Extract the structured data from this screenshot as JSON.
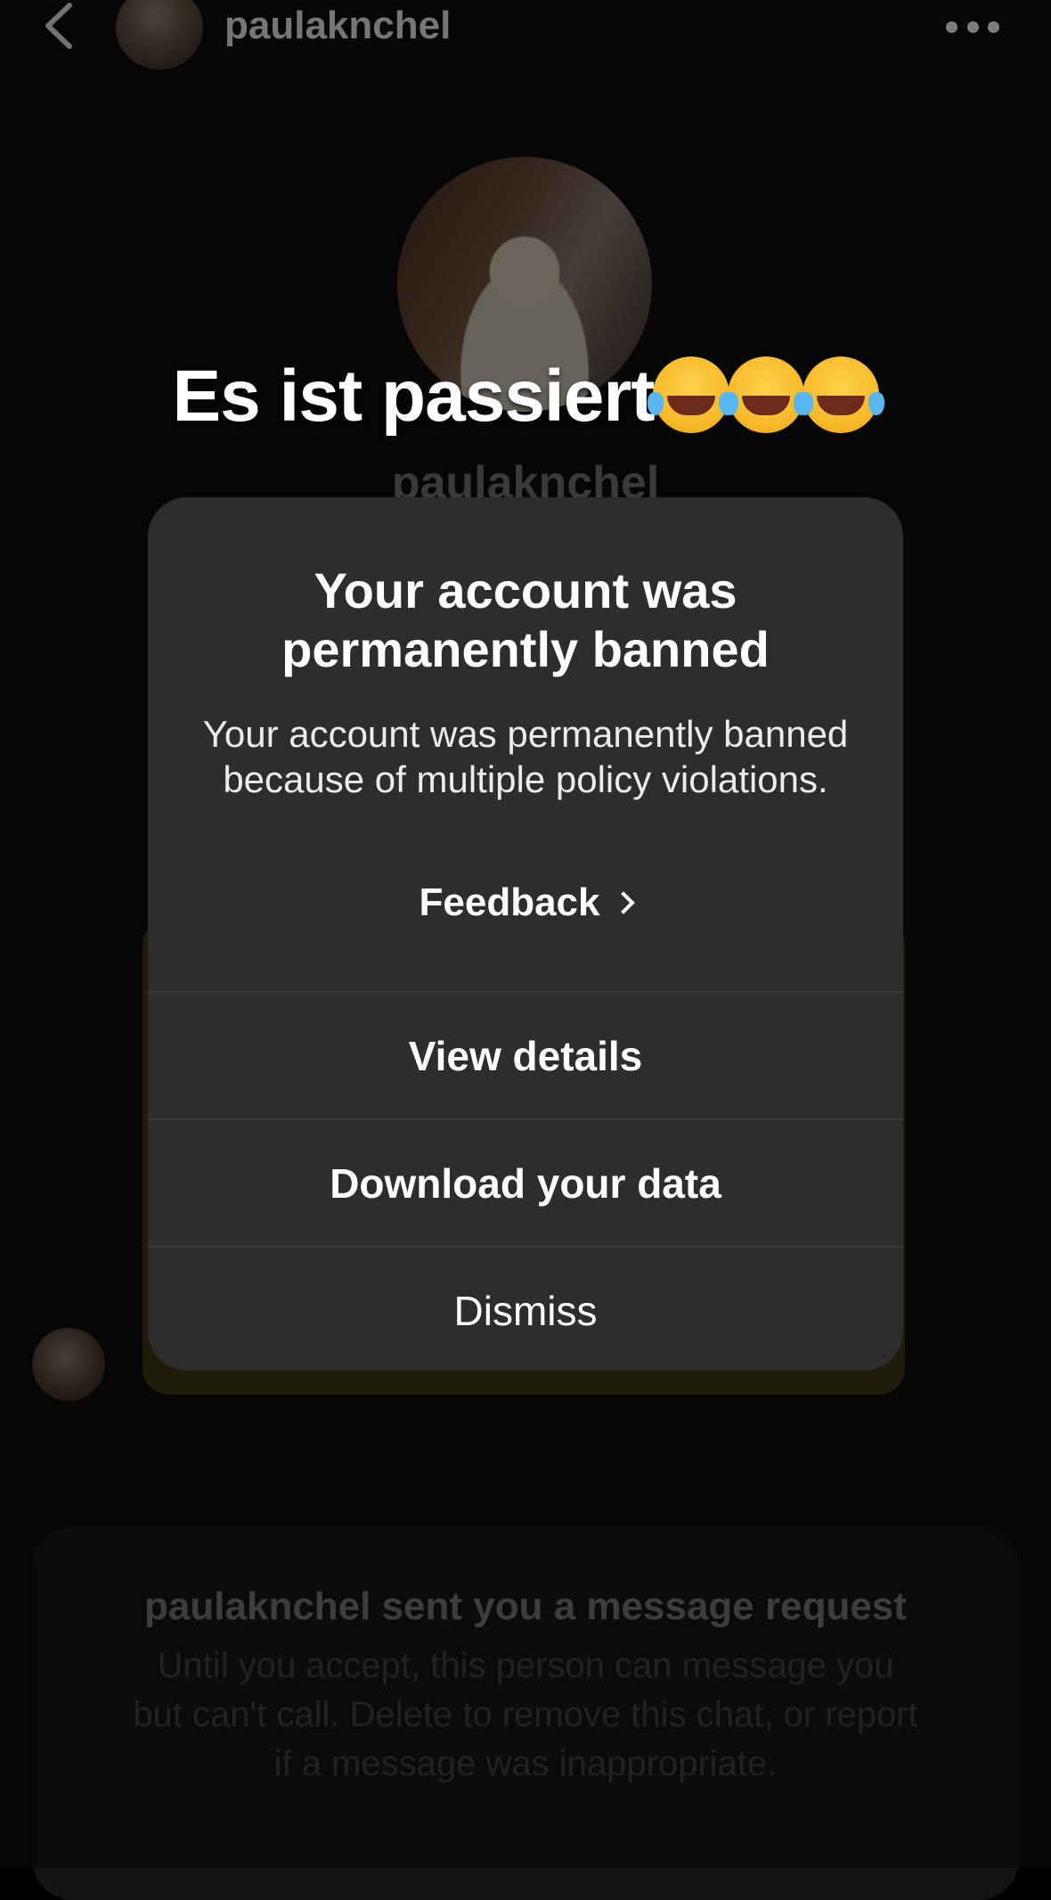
{
  "header": {
    "username": "paulaknchel"
  },
  "profile": {
    "username": "paulaknchel"
  },
  "overlay_caption": "Es ist passiert",
  "modal": {
    "title": "Your account was permanently banned",
    "body": "Your account was permanently banned because of multiple policy violations.",
    "feedback_label": "Feedback",
    "view_details_label": "View details",
    "download_label": "Download your data",
    "dismiss_label": "Dismiss"
  },
  "message_request": {
    "title": "paulaknchel sent you a message request",
    "body": "Until you accept, this person can message you but can't call. Delete to remove this chat, or report if a message was inappropriate."
  },
  "colors": {
    "modal_bg": "#2d2d2d",
    "background": "#000000"
  },
  "icons": [
    "back-chevron-icon",
    "more-dots-icon",
    "chevron-right-icon",
    "laughing-tears-emoji"
  ]
}
